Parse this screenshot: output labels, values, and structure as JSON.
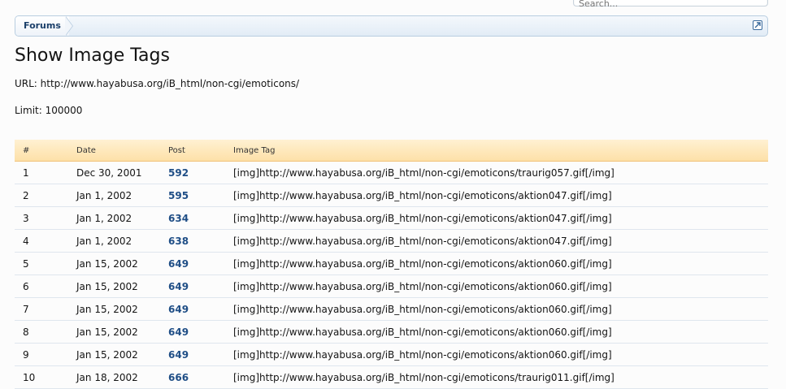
{
  "search": {
    "placeholder": "Search..."
  },
  "breadcrumb": {
    "items": [
      "Forums"
    ]
  },
  "page": {
    "title": "Show Image Tags",
    "url_line": "URL: http://www.hayabusa.org/iB_html/non-cgi/emoticons/",
    "limit_line": "Limit: 100000"
  },
  "table": {
    "headers": {
      "num": "#",
      "date": "Date",
      "post": "Post",
      "tag": "Image Tag"
    },
    "rows": [
      {
        "num": "1",
        "date": "Dec 30, 2001",
        "post": "592",
        "tag": "[img]http://www.hayabusa.org/iB_html/non-cgi/emoticons/traurig057.gif[/img]"
      },
      {
        "num": "2",
        "date": "Jan 1, 2002",
        "post": "595",
        "tag": "[img]http://www.hayabusa.org/iB_html/non-cgi/emoticons/aktion047.gif[/img]"
      },
      {
        "num": "3",
        "date": "Jan 1, 2002",
        "post": "634",
        "tag": "[img]http://www.hayabusa.org/iB_html/non-cgi/emoticons/aktion047.gif[/img]"
      },
      {
        "num": "4",
        "date": "Jan 1, 2002",
        "post": "638",
        "tag": "[img]http://www.hayabusa.org/iB_html/non-cgi/emoticons/aktion047.gif[/img]"
      },
      {
        "num": "5",
        "date": "Jan 15, 2002",
        "post": "649",
        "tag": "[img]http://www.hayabusa.org/iB_html/non-cgi/emoticons/aktion060.gif[/img]"
      },
      {
        "num": "6",
        "date": "Jan 15, 2002",
        "post": "649",
        "tag": "[img]http://www.hayabusa.org/iB_html/non-cgi/emoticons/aktion060.gif[/img]"
      },
      {
        "num": "7",
        "date": "Jan 15, 2002",
        "post": "649",
        "tag": "[img]http://www.hayabusa.org/iB_html/non-cgi/emoticons/aktion060.gif[/img]"
      },
      {
        "num": "8",
        "date": "Jan 15, 2002",
        "post": "649",
        "tag": "[img]http://www.hayabusa.org/iB_html/non-cgi/emoticons/aktion060.gif[/img]"
      },
      {
        "num": "9",
        "date": "Jan 15, 2002",
        "post": "649",
        "tag": "[img]http://www.hayabusa.org/iB_html/non-cgi/emoticons/aktion060.gif[/img]"
      },
      {
        "num": "10",
        "date": "Jan 18, 2002",
        "post": "666",
        "tag": "[img]http://www.hayabusa.org/iB_html/non-cgi/emoticons/traurig011.gif[/img]"
      }
    ]
  },
  "icons": {
    "popout": "popout-icon"
  },
  "colors": {
    "link": "#1f4e86",
    "header_bg": "#fde0a8",
    "breadcrumb_border": "#b8cde0"
  }
}
